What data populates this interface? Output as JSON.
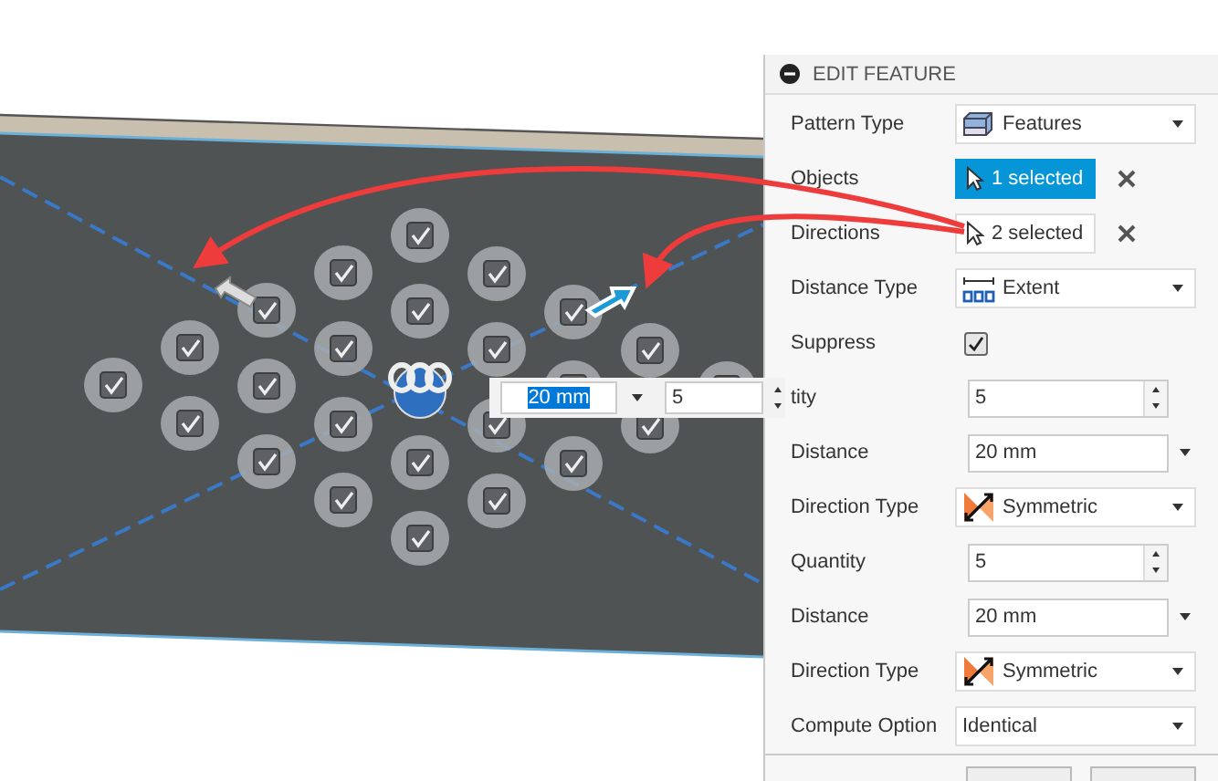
{
  "panel": {
    "title": "EDIT FEATURE",
    "rows": [
      {
        "label": "Pattern Type",
        "kind": "type-select",
        "value": "Features"
      },
      {
        "label": "Objects",
        "kind": "selection",
        "value": "1 selected",
        "selected": true
      },
      {
        "label": "Directions",
        "kind": "selection",
        "value": "2 selected",
        "selected": false
      },
      {
        "label": "Distance Type",
        "kind": "extent-select",
        "value": "Extent"
      },
      {
        "label": "Suppress",
        "kind": "checkbox",
        "checked": true
      },
      {
        "label": "tity",
        "kind": "spinner",
        "value": "5"
      },
      {
        "label": "Distance",
        "kind": "combo",
        "value": "20 mm"
      },
      {
        "label": "Direction Type",
        "kind": "direction-select",
        "value": "Symmetric"
      },
      {
        "label": "Quantity",
        "kind": "spinner",
        "value": "5"
      },
      {
        "label": "Distance",
        "kind": "combo",
        "value": "20 mm"
      },
      {
        "label": "Direction Type",
        "kind": "direction-select",
        "value": "Symmetric"
      },
      {
        "label": "Compute Option",
        "kind": "plain-select",
        "value": "Identical"
      }
    ]
  },
  "canvas_input": {
    "distance": "20 mm",
    "quantity": "5"
  }
}
